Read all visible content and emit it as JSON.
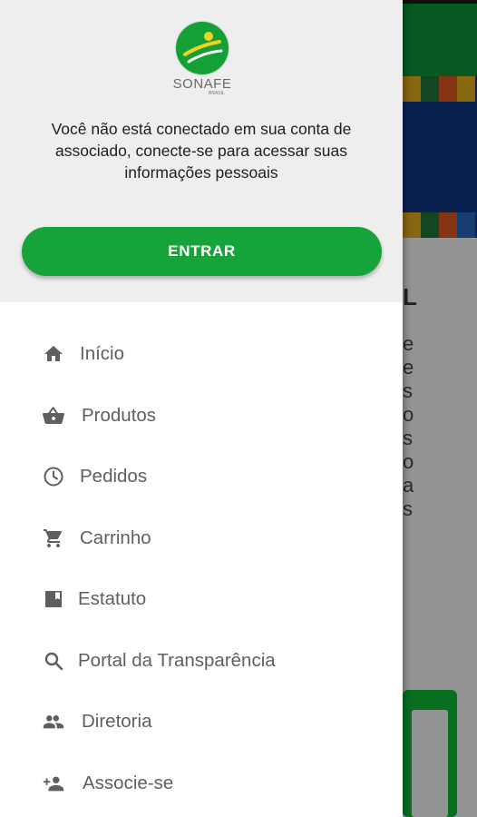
{
  "drawer": {
    "logo": {
      "name": "SONAFE",
      "sub": "BRASIL"
    },
    "message": "Você não está conectado em sua conta de associado, conecte-se para acessar suas informações pessoais",
    "enter_label": "ENTRAR",
    "items": [
      {
        "label": "Início",
        "icon": "home-icon"
      },
      {
        "label": "Produtos",
        "icon": "basket-icon"
      },
      {
        "label": "Pedidos",
        "icon": "clock-icon"
      },
      {
        "label": "Carrinho",
        "icon": "cart-icon"
      },
      {
        "label": "Estatuto",
        "icon": "book-icon"
      },
      {
        "label": "Portal da Transparência",
        "icon": "search-icon"
      },
      {
        "label": "Diretoria",
        "icon": "group-icon"
      },
      {
        "label": "Associe-se",
        "icon": "person-add-icon"
      }
    ]
  },
  "background": {
    "heading_fragment": "L",
    "text_fragments": [
      "e",
      "e",
      "s",
      "o",
      "s",
      "o",
      "a",
      "s"
    ]
  },
  "colors": {
    "accent": "#16a33a",
    "header_bg": "#eeeeee",
    "text": "#5f5f5f"
  }
}
